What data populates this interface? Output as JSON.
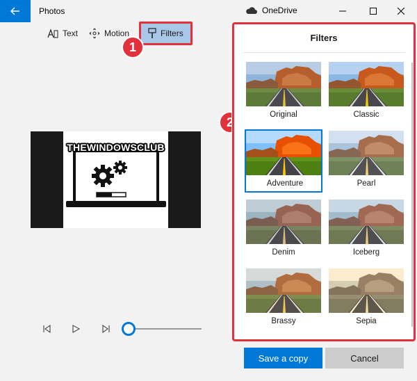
{
  "titlebar": {
    "app_title": "Photos",
    "cloud_label": "OneDrive",
    "accent_color": "#0078d7"
  },
  "toolbar": {
    "text_label": "Text",
    "motion_label": "Motion",
    "filters_label": "Filters"
  },
  "preview": {
    "watermark_text": "THEWINDOWSCLUB"
  },
  "callouts": {
    "first": "1",
    "second": "2"
  },
  "filters_panel": {
    "title": "Filters",
    "selected": "Adventure",
    "items": [
      {
        "label": "Original"
      },
      {
        "label": "Classic"
      },
      {
        "label": "Adventure"
      },
      {
        "label": "Pearl"
      },
      {
        "label": "Denim"
      },
      {
        "label": "Iceberg"
      },
      {
        "label": "Brassy"
      },
      {
        "label": "Sepia"
      }
    ]
  },
  "actions": {
    "save_label": "Save a copy",
    "cancel_label": "Cancel"
  },
  "player": {
    "progress": 0
  },
  "colors": {
    "highlight_red": "#e0313c",
    "accent_blue": "#0078d7"
  }
}
